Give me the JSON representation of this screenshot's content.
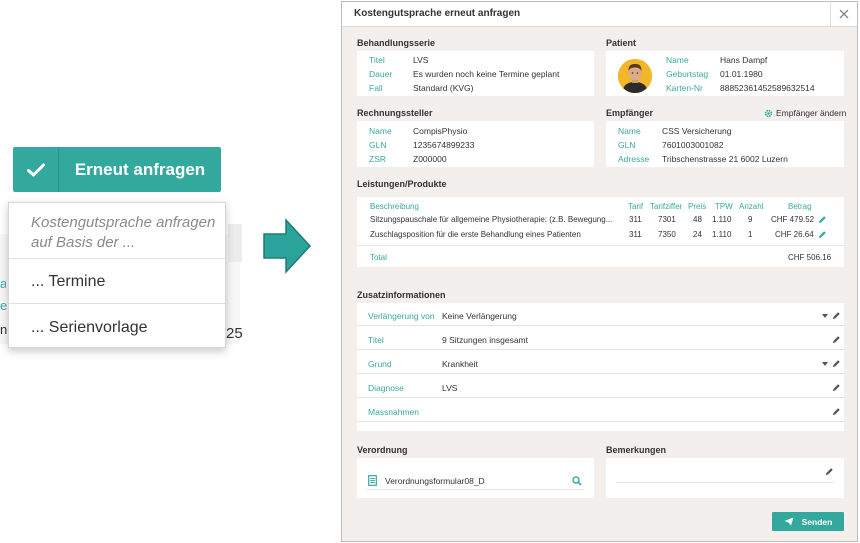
{
  "split_button": {
    "label": "Erneut anfragen"
  },
  "dropdown": {
    "hint": "Kostengutsprache anfragen auf Basis der ...",
    "items": [
      "... Termine",
      "... Serienvorlage"
    ]
  },
  "background_fragment": {
    "l1": "a",
    "l2": "e",
    "l3": "n",
    "number": "25"
  },
  "dialog": {
    "title": "Kostengutsprache erneut anfragen",
    "behandlungsserie": {
      "heading": "Behandlungsserie",
      "titel_label": "Titel",
      "titel": "LVS",
      "dauer_label": "Dauer",
      "dauer": "Es wurden noch keine Termine geplant",
      "fall_label": "Fall",
      "fall": "Standard (KVG)"
    },
    "patient": {
      "heading": "Patient",
      "name_label": "Name",
      "name": "Hans Dampf",
      "geburtstag_label": "Geburtstag",
      "geburtstag": "01.01.1980",
      "karten_label": "Karten-Nr",
      "karten": "88852361452589632514"
    },
    "rechnungssteller": {
      "heading": "Rechnungssteller",
      "name_label": "Name",
      "name": "CompisPhysio",
      "gln_label": "GLN",
      "gln": "1235674899233",
      "zsr_label": "ZSR",
      "zsr": "Z000000"
    },
    "empfaenger": {
      "heading": "Empfänger",
      "change_label": "Empfänger ändern",
      "name_label": "Name",
      "name": "CSS Versicherung",
      "gln_label": "GLN",
      "gln": "7601003001082",
      "adresse_label": "Adresse",
      "adresse": "Tribschenstrasse 21 6002 Luzern"
    },
    "leistungen": {
      "heading": "Leistungen/Produkte",
      "headers": {
        "beschreibung": "Beschreibung",
        "tarif": "Tarif",
        "tarifziffer": "Tarifziffer",
        "preis": "Preis",
        "tpw": "TPW",
        "anzahl": "Anzahl",
        "betrag": "Betrag"
      },
      "rows": [
        {
          "beschreibung": "Sitzungspauschale für allgemeine Physiotherapie: (z.B. Bewegung...",
          "tarif": "311",
          "tarifziffer": "7301",
          "preis": "48",
          "tpw": "1.110",
          "anzahl": "9",
          "betrag": "CHF 479.52"
        },
        {
          "beschreibung": "Zuschlagsposition für die erste Behandlung eines Patienten",
          "tarif": "311",
          "tarifziffer": "7350",
          "preis": "24",
          "tpw": "1.110",
          "anzahl": "1",
          "betrag": "CHF 26.64"
        }
      ],
      "total_label": "Total",
      "total": "CHF 506.16"
    },
    "zusatz": {
      "heading": "Zusatzinformationen",
      "verlaengerung_label": "Verlängerung von",
      "verlaengerung": "Keine Verlängerung",
      "titel_label": "Titel",
      "titel": "9 Sitzungen insgesamt",
      "grund_label": "Grund",
      "grund": "Krankheit",
      "diagnose_label": "Diagnose",
      "diagnose": "LVS",
      "massnahmen_label": "Massnahmen",
      "massnahmen": ""
    },
    "verordnung": {
      "heading": "Verordnung",
      "file": "Verordnungsformular08_D"
    },
    "bemerkungen": {
      "heading": "Bemerkungen",
      "text": ""
    },
    "send_label": "Senden"
  },
  "colors": {
    "accent": "#33a99e",
    "label": "#3aa89f",
    "dialog_bg": "#f2efec"
  }
}
